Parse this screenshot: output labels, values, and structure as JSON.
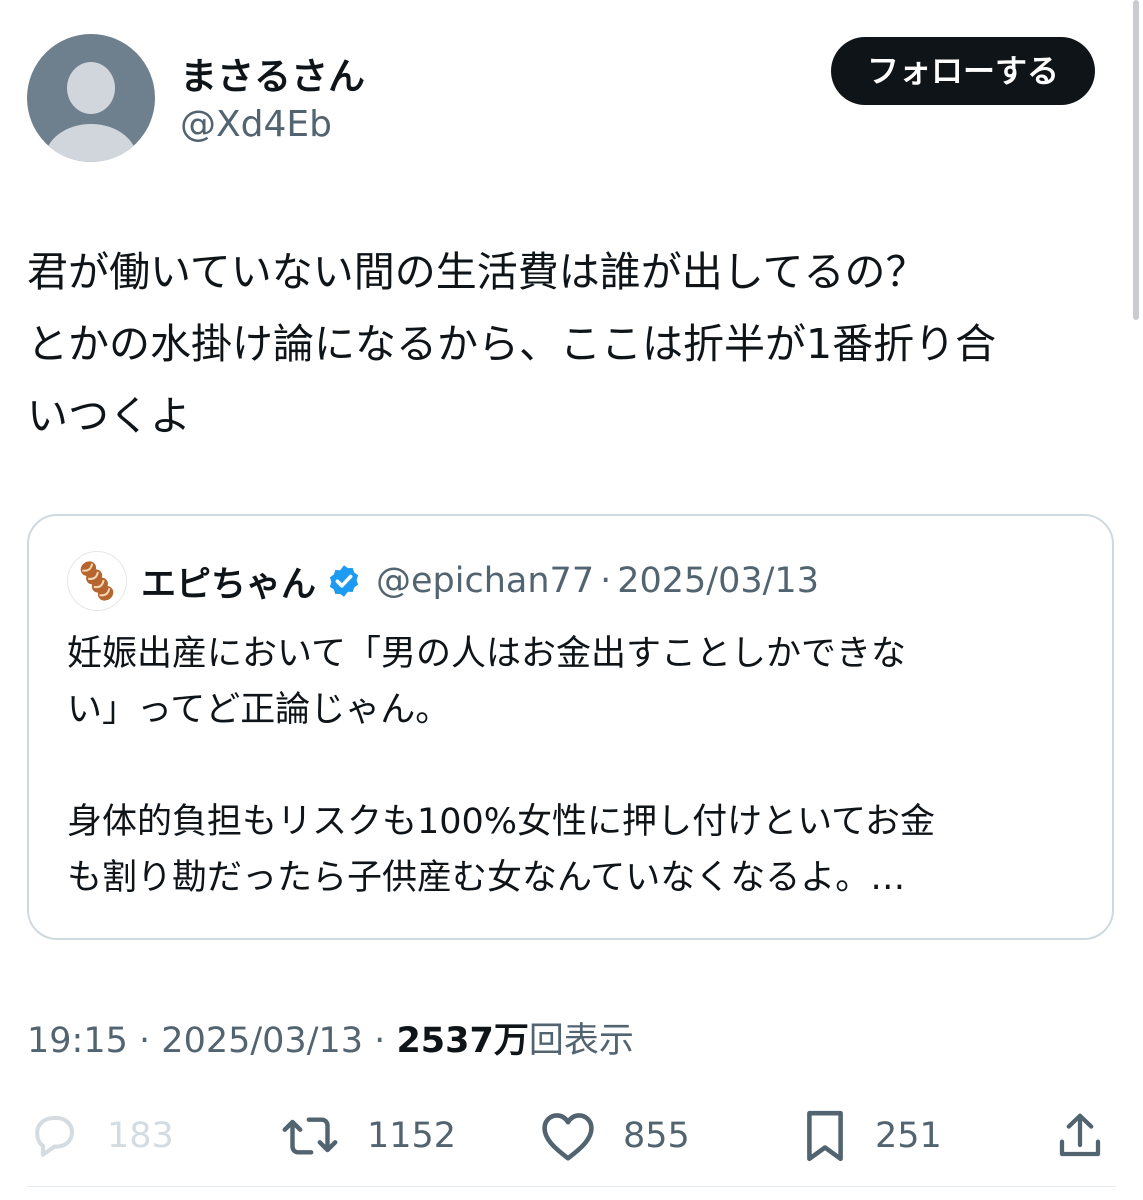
{
  "header": {
    "display_name": "まさるさん",
    "handle": "@Xd4Eb",
    "follow_label": "フォローする"
  },
  "tweet": {
    "lines": [
      "君が働いていない間の生活費は誰が出してるの？",
      "とかの水掛け論になるから、ここは折半が1番折り合",
      "いつくよ"
    ]
  },
  "quote": {
    "name": "エピちゃん",
    "handle": "@epichan77",
    "separator": "·",
    "date": "2025/03/13",
    "lines": [
      "妊娠出産において「男の人はお金出すことしかできな",
      "い」ってど正論じゃん。",
      "",
      "身体的負担もリスクも100%女性に押し付けといてお金",
      "も割り勘だったら子供産む女なんていなくなるよ。…"
    ]
  },
  "meta": {
    "time": "19:15",
    "separator": "·",
    "date": "2025/03/13",
    "views_count": "2537万",
    "views_label": "回表示"
  },
  "actions": {
    "reply_count": "183",
    "retweet_count": "1152",
    "like_count": "855",
    "bookmark_count": "251"
  },
  "icons": {
    "reply": "reply-icon",
    "retweet": "retweet-icon",
    "like": "heart-icon",
    "bookmark": "bookmark-icon",
    "share": "share-icon",
    "verified": "verified-badge-icon"
  },
  "colors": {
    "text_primary": "#0f1419",
    "text_secondary": "#536471",
    "verified_blue": "#1d9bf0",
    "border": "#cfd9de"
  }
}
